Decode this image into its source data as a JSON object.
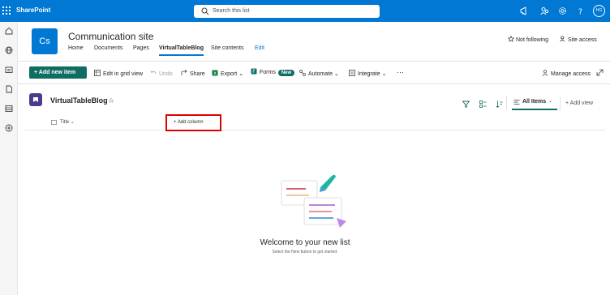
{
  "suite": {
    "app_name": "SharePoint",
    "search_placeholder": "Search this list",
    "user_initials": "HG"
  },
  "site": {
    "logo_initials": "Cs",
    "title": "Communication site",
    "nav": [
      "Home",
      "Documents",
      "Pages",
      "VirtualTableBlog",
      "Site contents",
      "Edit"
    ],
    "follow_label": "Not following",
    "site_access_label": "Site access"
  },
  "commandbar": {
    "new_item": "+ Add new item",
    "edit_grid": "Edit in grid view",
    "undo": "Undo",
    "share": "Share",
    "export": "Export",
    "forms": "Forms",
    "forms_badge": "New",
    "automate": "Automate",
    "integrate": "Integrate",
    "more": "···",
    "manage_access": "Manage access"
  },
  "list": {
    "name": "VirtualTableBlog",
    "view_name": "All Items",
    "add_view": "+ Add view",
    "columns": [
      "Title"
    ],
    "add_column": "+ Add column"
  },
  "empty_state": {
    "heading": "Welcome to your new list",
    "subtext": "Select the New button to get started."
  },
  "colors": {
    "suite_bar": "#0078d4",
    "primary_button": "#0f6d63",
    "highlight_box": "#e00000",
    "list_icon": "#4f3b8c"
  }
}
